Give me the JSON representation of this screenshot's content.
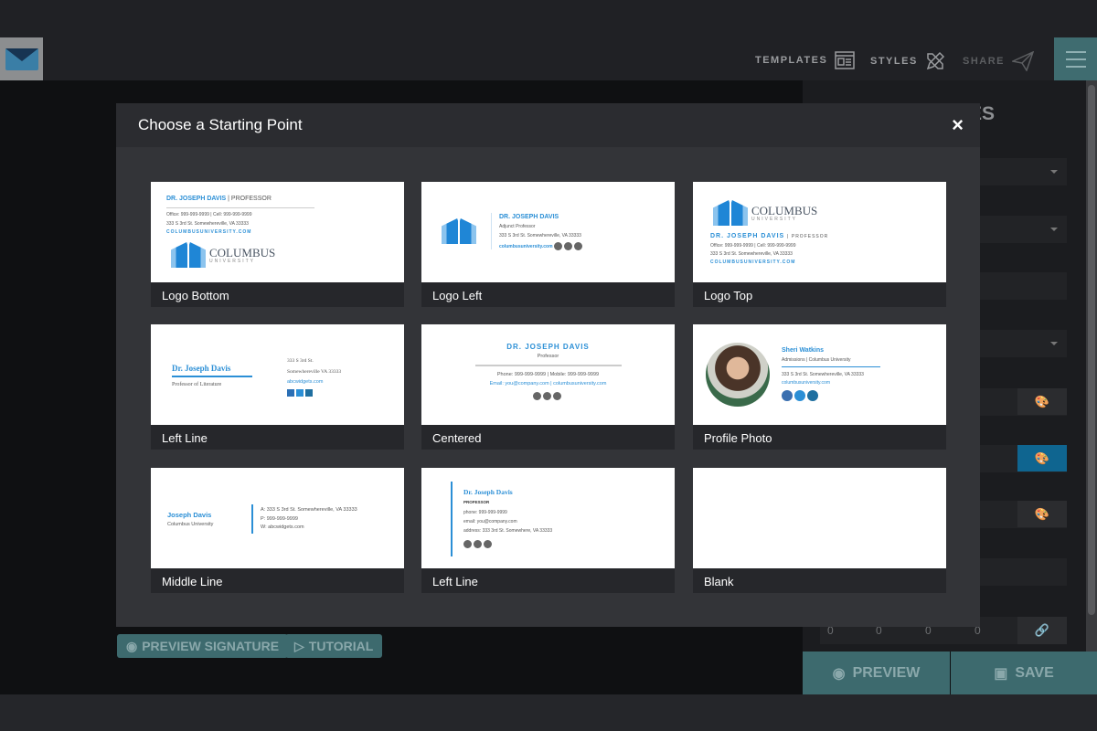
{
  "header": {
    "nav": [
      {
        "label": "TEMPLATES",
        "icon": "templates-icon"
      },
      {
        "label": "STYLES",
        "icon": "styles-icon"
      },
      {
        "label": "SHARE",
        "icon": "paper-plane-icon"
      }
    ]
  },
  "panel": {
    "title_fragment": "ES",
    "spacing_values": [
      "0",
      "0",
      "0",
      "0"
    ]
  },
  "buttons": {
    "preview_signature": "PREVIEW SIGNATURE",
    "tutorial": "TUTORIAL",
    "preview": "PREVIEW",
    "save": "SAVE"
  },
  "colors": {
    "accent_teal": "#3d6a6e",
    "accent_blue": "#0f6590",
    "link_blue": "#2b8fd6"
  },
  "modal": {
    "title": "Choose a Starting Point",
    "close": "×",
    "templates": [
      {
        "label": "Logo Bottom",
        "name": "DR. JOSEPH DAVIS",
        "title": "| PROFESSOR",
        "line1": "Office: 999-999-9999 | Cell: 999-999-9999",
        "address": "333 S 3rd St. Somewhereville, VA 33333",
        "web": "COLUMBUSUNIVERSITY.COM",
        "logo": "COLUMBUS",
        "logo_sub": "UNIVERSITY"
      },
      {
        "label": "Logo Left",
        "name": "DR. JOSEPH DAVIS",
        "title": "Adjunct Professor",
        "address": "333 S 3rd St. Somewhereville, VA 33333",
        "web": "columbusuniversity.com"
      },
      {
        "label": "Logo Top",
        "logo": "COLUMBUS",
        "logo_sub": "UNIVERSITY",
        "name": "DR. JOSEPH DAVIS",
        "title": "| PROFESSOR",
        "line1": "Office: 999-999-9999 | Cell: 999-999-9999",
        "address": "333 S 3rd St. Somewhereville, VA 33333",
        "web": "COLUMBUSUNIVERSITY.COM"
      },
      {
        "label": "Left Line",
        "name": "Dr. Joseph Davis",
        "title": "Professor of Literature",
        "address1": "333 S 3rd St.",
        "address2": "Somewhereville VA 33333",
        "web": "abcwidgets.com"
      },
      {
        "label": "Centered",
        "name": "DR. JOSEPH DAVIS",
        "title": "Professor",
        "line1": "Phone: 999-999-9999 | Mobile: 999-999-9999",
        "line2": "Email: you@company.com | columbusuniversity.com"
      },
      {
        "label": "Profile Photo",
        "name": "Sheri Watkins",
        "title": "Admissions | Columbus University",
        "address": "333 S 3rd St. Somewhereville, VA 33333",
        "web": "columbusuniversity.com"
      },
      {
        "label": "Middle Line",
        "name": "Joseph Davis",
        "title": "Columbus University",
        "line1": "A: 333 S 3rd St. Somewhereville, VA 33333",
        "line2": "P: 999-999-9999",
        "line3": "W: abcwidgets.com"
      },
      {
        "label": "Left Line",
        "name": "Dr. Joseph Davis",
        "title": "PROFESSOR",
        "line1": "phone: 999-999-9999",
        "line2": "email: you@company.com",
        "line3": "address: 333 3rd St. Somewhere, VA 33333"
      },
      {
        "label": "Blank"
      }
    ]
  }
}
